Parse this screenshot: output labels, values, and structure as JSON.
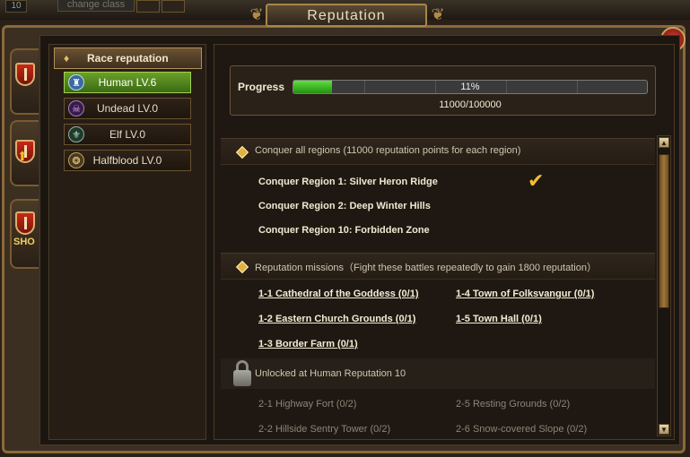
{
  "topbar": {
    "level": "10",
    "button_label": "change class"
  },
  "window": {
    "title": "Reputation",
    "close_glyph": "✕"
  },
  "side_tabs": [
    {
      "icon": "shield-icon"
    },
    {
      "icon": "shield-upgrade-icon"
    },
    {
      "icon": "shield-shop-icon",
      "label": "SHO"
    }
  ],
  "race_header": {
    "label": "Race reputation"
  },
  "races": [
    {
      "label": "Human LV.6",
      "icon": "human-crest-icon",
      "active": true
    },
    {
      "label": "Undead LV.0",
      "icon": "undead-skull-icon",
      "active": false
    },
    {
      "label": "Elf LV.0",
      "icon": "elf-leaf-icon",
      "active": false
    },
    {
      "label": "Halfblood LV.0",
      "icon": "halfblood-beast-icon",
      "active": false
    }
  ],
  "progress": {
    "label": "Progress",
    "percent_text": "11%",
    "fraction": 0.11,
    "count_text": "11000/100000"
  },
  "conquer": {
    "header": "Conquer all regions (11000 reputation points for each region)",
    "regions": [
      {
        "label": "Conquer Region 1: Silver Heron Ridge",
        "completed": true
      },
      {
        "label": "Conquer Region 2: Deep Winter Hills",
        "completed": false
      },
      {
        "label": "Conquer Region 10: Forbidden Zone",
        "completed": false
      }
    ]
  },
  "missions": {
    "header": "Reputation missions（Fight these battles repeatedly to gain 1800 reputation）",
    "items": [
      "1-1 Cathedral of the Goddess (0/1)",
      "1-4 Town of Folksvangur (0/1)",
      "1-2 Eastern Church Grounds (0/1)",
      "1-5 Town Hall (0/1)",
      "1-3 Border Farm (0/1)"
    ]
  },
  "locked": {
    "header": "Unlocked at Human Reputation 10",
    "items": [
      "2-1 Highway Fort (0/2)",
      "2-5 Resting Grounds (0/2)",
      "2-2 Hillside Sentry Tower (0/2)",
      "2-6 Snow-covered Slope (0/2)"
    ]
  },
  "colors": {
    "accent_gold": "#b08a4a",
    "progress_green": "#40c020",
    "active_race": "#5a9020"
  }
}
